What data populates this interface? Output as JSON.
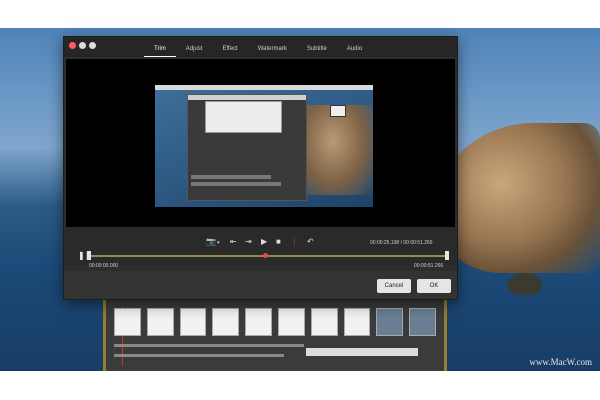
{
  "window": {
    "tabs": [
      {
        "label": "Trim",
        "active": true
      },
      {
        "label": "Adjust"
      },
      {
        "label": "Effect"
      },
      {
        "label": "Watermark"
      },
      {
        "label": "Subtitle"
      },
      {
        "label": "Audio"
      }
    ]
  },
  "player": {
    "current_time": "00:00:25.198 / 00:00:51.266",
    "trim_start": "00:00:00.000",
    "trim_end": "00:00:51.266",
    "playhead_fraction": 0.49
  },
  "icons": {
    "snapshot": "camera-icon",
    "dropdown": "chevron-down-icon",
    "prev": "prev-frame-icon",
    "next": "next-frame-icon",
    "play": "play-icon",
    "stop": "stop-icon",
    "mark": "marker-icon",
    "rotate": "rotate-icon",
    "pause": "pause-icon"
  },
  "buttons": {
    "cancel": "Cancel",
    "ok": "OK"
  },
  "watermark_text": "www.MacW.com",
  "colors": {
    "accent": "#ff5f56",
    "playhead": "#e74c3c",
    "track": "#9a8a4a"
  }
}
